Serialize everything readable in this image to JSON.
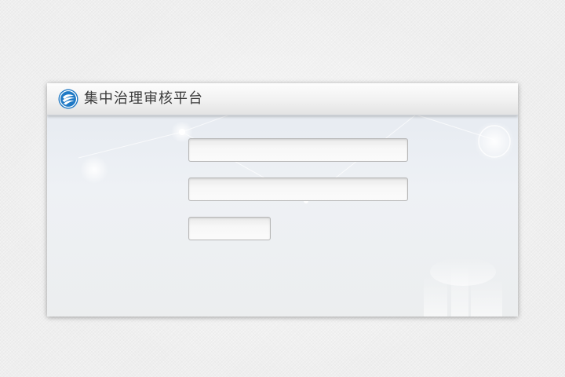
{
  "header": {
    "title": "集中治理审核平台",
    "logo_icon": "china-mobile-logo-icon"
  },
  "login_form": {
    "username": {
      "value": "",
      "placeholder": ""
    },
    "password": {
      "value": "",
      "placeholder": ""
    },
    "captcha": {
      "value": "",
      "placeholder": ""
    }
  },
  "colors": {
    "title_text": "#3a3a3a",
    "logo_blue": "#1f79c5",
    "page_background": "#eeeeee",
    "panel_background": "#e8ecf2"
  }
}
